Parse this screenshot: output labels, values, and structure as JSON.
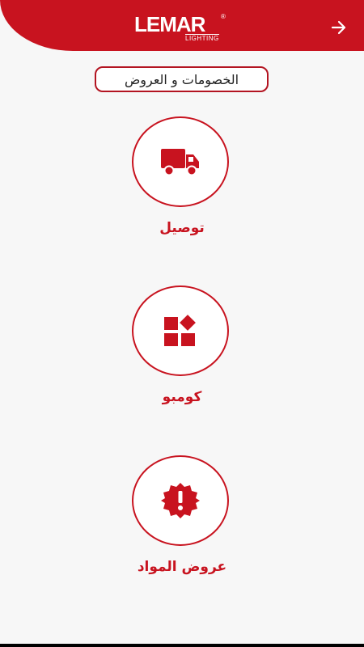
{
  "header": {
    "brand_name": "LEMAR",
    "brand_registered": "®",
    "brand_subtitle": "LIGHTING",
    "forward_icon": "arrow-right-icon",
    "color": "#c8131f"
  },
  "page_title": "الخصومات و العروض",
  "menu": {
    "items": [
      {
        "label": "توصيل",
        "icon": "delivery-truck-icon"
      },
      {
        "label": "كومبو",
        "icon": "combo-shapes-icon"
      },
      {
        "label": "عروض المواد",
        "icon": "offer-badge-icon"
      }
    ]
  },
  "colors": {
    "accent": "#c8131f",
    "background": "#f7f7f7"
  }
}
